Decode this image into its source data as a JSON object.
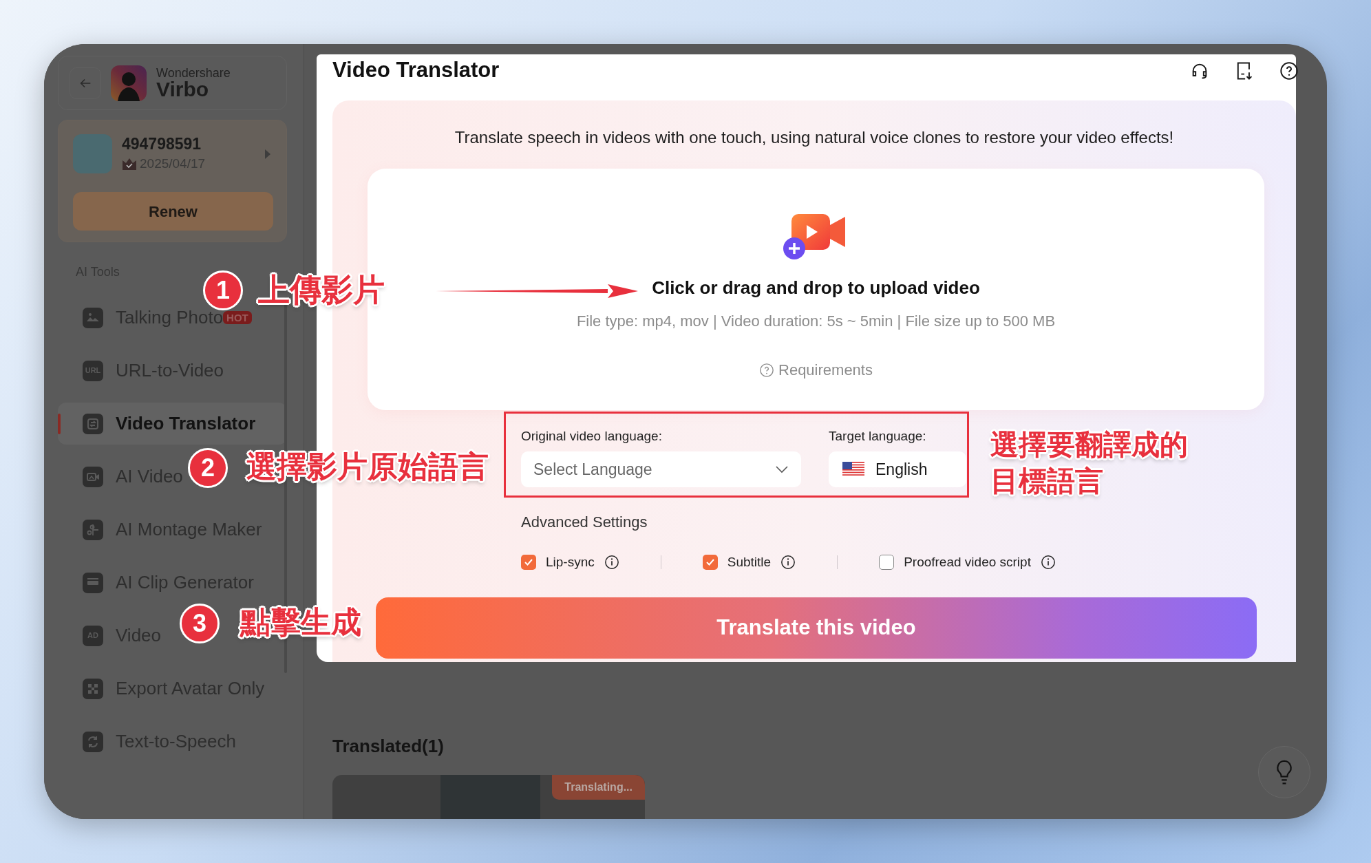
{
  "app": {
    "brand_small": "Wondershare",
    "brand_name": "Virbo"
  },
  "account": {
    "user_id": "494798591",
    "date": "2025/04/17",
    "renew_button": "Renew"
  },
  "sidebar": {
    "section_title": "AI Tools",
    "items": [
      {
        "label": "Talking Photo",
        "selected": false,
        "badge": "HOT"
      },
      {
        "label": "URL-to-Video",
        "selected": false,
        "icon_text": "URL"
      },
      {
        "label": "Video Translator",
        "selected": true
      },
      {
        "label": "AI Video",
        "selected": false
      },
      {
        "label": "AI Montage Maker",
        "selected": false
      },
      {
        "label": "AI Clip Generator",
        "selected": false
      },
      {
        "label": "Video",
        "selected": false,
        "icon_text": "AD"
      },
      {
        "label": "Export Avatar Only",
        "selected": false
      },
      {
        "label": "Text-to-Speech",
        "selected": false
      }
    ]
  },
  "page": {
    "title": "Video Translator",
    "subtitle": "Translate speech in videos with one touch, using natural voice clones to restore your video effects!",
    "upload": {
      "prompt": "Click or drag and drop to upload video",
      "file_info": "File type: mp4, mov | Video duration: 5s ~ 5min | File size up to 500 MB",
      "requirements_link": "Requirements"
    },
    "languages": {
      "original_label": "Original video language:",
      "original_placeholder": "Select Language",
      "target_label": "Target language:",
      "target_value": "English"
    },
    "advanced": {
      "title": "Advanced Settings",
      "options": [
        {
          "label": "Lip-sync",
          "checked": true
        },
        {
          "label": "Subtitle",
          "checked": true
        },
        {
          "label": "Proofread video script",
          "checked": false
        }
      ]
    },
    "translate_button": "Translate this video"
  },
  "translated": {
    "title": "Translated(1)",
    "items": [
      {
        "status": "Translating..."
      }
    ]
  },
  "annotations": {
    "steps": [
      {
        "number": "1",
        "text": "上傳影片"
      },
      {
        "number": "2",
        "text": "選擇影片原始語言"
      },
      {
        "number": "3",
        "text": "點擊生成"
      }
    ],
    "target_note": [
      "選擇要翻譯成的",
      "目標語言"
    ]
  }
}
